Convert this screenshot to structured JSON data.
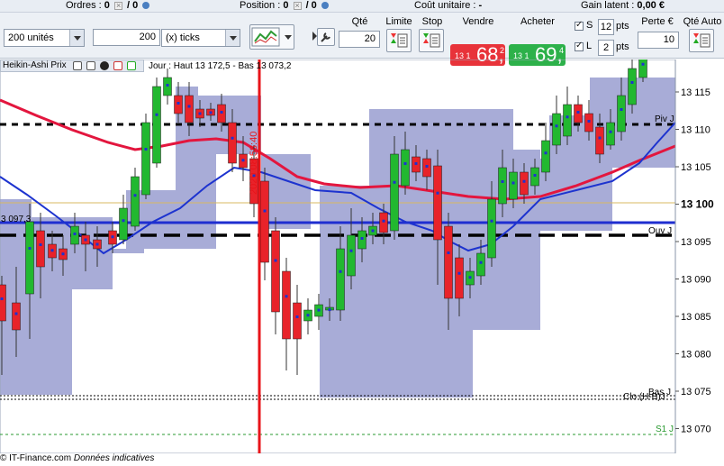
{
  "topbar": {
    "orders_label": "Ordres :",
    "orders_value": "0",
    "orders_total": "/ 0",
    "position_label": "Position :",
    "position_value": "0",
    "position_total": "/ 0",
    "unit_cost_label": "Coût unitaire :",
    "unit_cost_value": "-",
    "latent_gain_label": "Gain latent :",
    "latent_gain_value": "0,00 €"
  },
  "toolbar": {
    "units_select": "200 unités",
    "ticks_value": "200",
    "ticks_select": "(x) ticks",
    "qty_label": "Qté",
    "qty_value": "20",
    "limit_label": "Limite",
    "stop_label": "Stop",
    "sell_label": "Vendre",
    "buy_label": "Acheter",
    "sell_prefix": "13 1",
    "sell_big": "68,",
    "sell_sup": "2",
    "buy_prefix": "13 1",
    "buy_big": "69,",
    "buy_sup": "4",
    "s_label": "S",
    "s_value": "12",
    "l_label": "L",
    "l_value": "2",
    "pts_label": "pts",
    "loss_label": "Perte €",
    "loss_value": "10",
    "qty_auto_label": "Qté Auto",
    "sell_color": "#e8333a",
    "buy_color": "#2db14a"
  },
  "chart": {
    "indicator_label": "Heikin-Ashi Prix",
    "info": "Jour : Haut 13 172,5 - Bas 13 073,2",
    "time_label": "2020 08:58:40",
    "left_price_label": "3 097,3",
    "line_labels": {
      "piv": "Piv J",
      "ouv": "Ouv J",
      "clo": "Clo (H-B)J",
      "bas": "Bas J",
      "s1": "S1 J"
    },
    "y_ticks": [
      "13 115",
      "13 110",
      "13 105",
      "13 100",
      "13 095",
      "13 090",
      "13 085",
      "13 080",
      "13 075",
      "13 070"
    ],
    "highlight_tick": "13 100",
    "colors": {
      "up": "#22b830",
      "down": "#e8232a",
      "band": "#9fa3d3",
      "ma_red": "#e3163e",
      "ma_blue": "#1d33cf",
      "cursor": "#e8141a"
    }
  },
  "footer": {
    "brand": "© IT-Finance.com",
    "note": "Données indicatives"
  }
}
